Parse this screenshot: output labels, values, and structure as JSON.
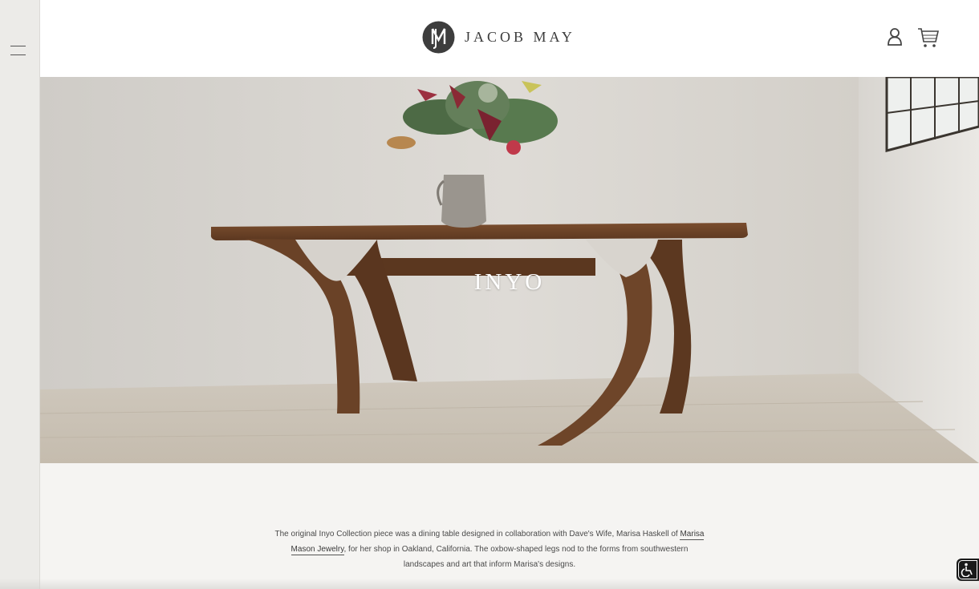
{
  "header": {
    "brand": "JACOB MAY",
    "menu_icon": "hamburger-menu-icon",
    "account_icon": "user-account-icon",
    "cart_icon": "shopping-cart-icon"
  },
  "hero": {
    "title": "INYO"
  },
  "description": {
    "text_before_link": "The original Inyo Collection piece was a dining table designed in collaboration with Dave's Wife, Marisa Haskell of ",
    "link_text": "Marisa Mason Jewelry",
    "text_after_link": ", for her shop in Oakland, California. The oxbow-shaped legs nod to the forms from southwestern landscapes and art that inform Marisa's designs."
  },
  "accessibility": {
    "icon": "wheelchair-accessibility-icon"
  },
  "colors": {
    "sidebar": "#ecebe8",
    "header": "#ffffff",
    "body": "#f5f4f2",
    "wood": "#6e4429"
  }
}
